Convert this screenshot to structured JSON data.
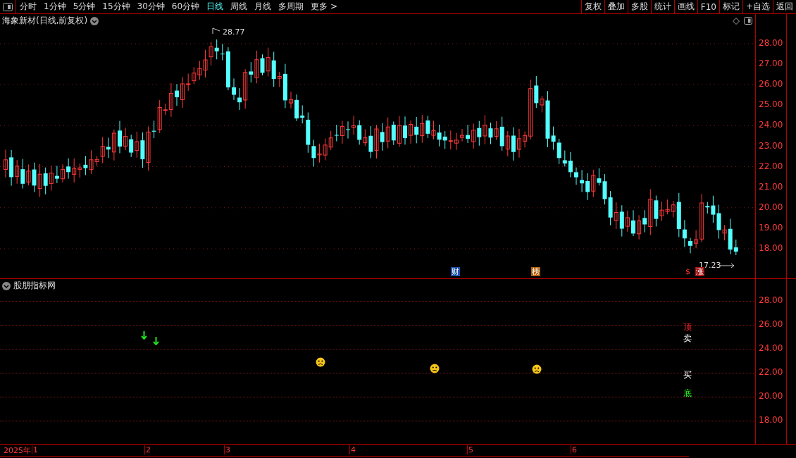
{
  "toolbar": {
    "periods": [
      {
        "label": "分时",
        "selected": false
      },
      {
        "label": "1分钟",
        "selected": false
      },
      {
        "label": "5分钟",
        "selected": false
      },
      {
        "label": "15分钟",
        "selected": false
      },
      {
        "label": "30分钟",
        "selected": false
      },
      {
        "label": "60分钟",
        "selected": false
      },
      {
        "label": "日线",
        "selected": true
      },
      {
        "label": "周线",
        "selected": false
      },
      {
        "label": "月线",
        "selected": false
      },
      {
        "label": "多周期",
        "selected": false
      },
      {
        "label": "更多 >",
        "selected": false
      }
    ],
    "buttons": [
      "复权",
      "叠加",
      "多股",
      "统计",
      "画线",
      "F10",
      "标记",
      "+自选",
      "返回"
    ]
  },
  "main_chart": {
    "title": "海象新材(日线,前复权)",
    "axis_labels": [
      "28.00",
      "27.00",
      "26.00",
      "25.00",
      "24.00",
      "23.00",
      "22.00",
      "21.00",
      "20.00",
      "19.00",
      "18.00"
    ],
    "high_marker": "28.77",
    "low_marker": "17.23",
    "badges": [
      {
        "text": "财",
        "color": "#1e4fa8"
      },
      {
        "text": "榜",
        "color": "#b0620e"
      },
      {
        "text": "$",
        "color": "#000000"
      },
      {
        "text": "涨",
        "color": "#a01010"
      }
    ]
  },
  "indicator": {
    "title": "股朋指标网",
    "axis_labels": [
      "28.00",
      "26.00",
      "24.00",
      "22.00",
      "20.00",
      "18.00"
    ],
    "signals": [
      {
        "text": "顶",
        "kind": "top"
      },
      {
        "text": "卖",
        "kind": "sell"
      },
      {
        "text": "买",
        "kind": "buy"
      },
      {
        "text": "底",
        "kind": "bottom"
      }
    ]
  },
  "time_axis": {
    "year": "2025年",
    "months": [
      "1",
      "2",
      "3",
      "4",
      "5",
      "6"
    ]
  }
}
